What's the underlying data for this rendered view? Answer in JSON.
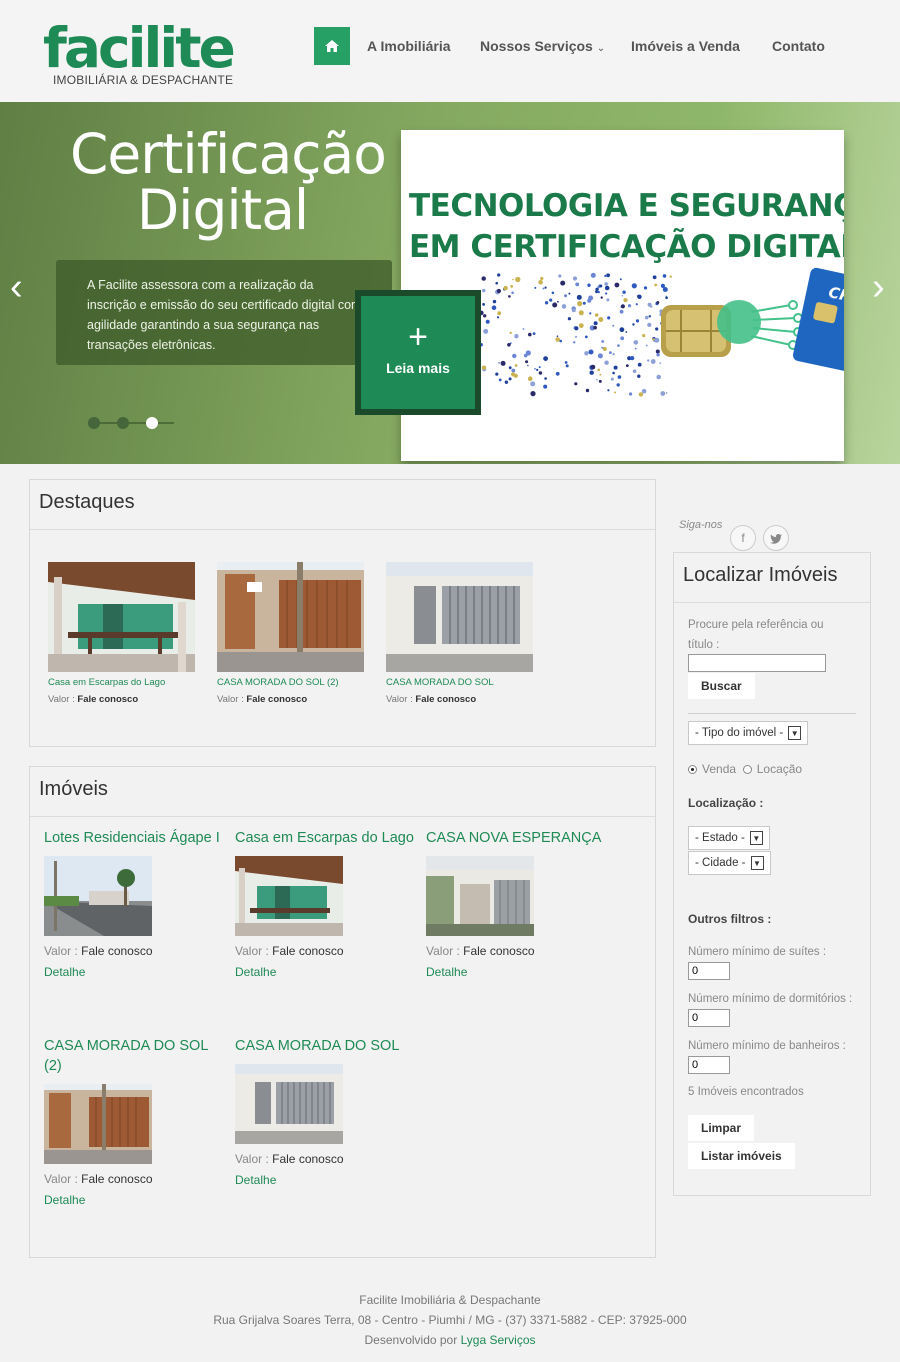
{
  "header": {
    "logo_word": "facilite",
    "logo_sub": "IMOBILIÁRIA & DESPACHANTE",
    "nav": {
      "home_icon": "home-icon",
      "items": [
        "A Imobiliária",
        "Nossos Serviços",
        "Imóveis a Venda",
        "Contato"
      ],
      "dropdown_glyph": "⌄"
    }
  },
  "slider": {
    "title_line1": "Certificação",
    "title_line2": "Digital",
    "caption": "A Facilite assessora com a realização da inscrição e emissão do seu certificado digital com agilidade garantindo a sua segurança nas transações eletrônicas.",
    "button_plus": "+",
    "button_label": "Leia mais",
    "banner_line1": "TECNOLOGIA E SEGURANÇA",
    "banner_line2": "EM CERTIFICAÇÃO DIGITAL",
    "card_text": "CPF",
    "active_dot": 2,
    "prev_arrow": "‹",
    "next_arrow": "›",
    "colors": {
      "brand": "#1e8a55",
      "brand_dark": "#1b7a49"
    }
  },
  "destaques": {
    "title": "Destaques",
    "items": [
      {
        "name": "Casa em Escarpas do Lago",
        "value_label": "Valor :",
        "value": "Fale conosco"
      },
      {
        "name": "CASA MORADA DO SOL (2)",
        "value_label": "Valor :",
        "value": "Fale conosco"
      },
      {
        "name": "CASA MORADA DO SOL",
        "value_label": "Valor :",
        "value": "Fale conosco"
      }
    ]
  },
  "imoveis": {
    "title": "Imóveis",
    "items": [
      {
        "name": "Lotes Residenciais Ágape I",
        "value_label": "Valor :",
        "value": "Fale conosco",
        "detail": "Detalhe"
      },
      {
        "name": "Casa em Escarpas do Lago",
        "value_label": "Valor :",
        "value": "Fale conosco",
        "detail": "Detalhe"
      },
      {
        "name": "CASA NOVA ESPERANÇA",
        "value_label": "Valor :",
        "value": "Fale conosco",
        "detail": "Detalhe"
      },
      {
        "name": "CASA MORADA DO SOL (2)",
        "value_label": "Valor :",
        "value": "Fale conosco",
        "detail": "Detalhe"
      },
      {
        "name": "CASA MORADA DO SOL",
        "value_label": "Valor :",
        "value": "Fale conosco",
        "detail": "Detalhe"
      }
    ]
  },
  "sidebar": {
    "siga": "Siga-nos",
    "social": [
      "f",
      "t"
    ],
    "title": "Localizar Imóveis",
    "search_label": "Procure pela referência ou título :",
    "search_value": "",
    "search_button": "Buscar",
    "tipo_select": "- Tipo do imóvel -",
    "radio_venda": "Venda",
    "radio_locacao": "Locação",
    "localizacao_label": "Localização :",
    "estado_select": "- Estado -",
    "cidade_select": "- Cidade -",
    "outros_label": "Outros filtros :",
    "suites_label": "Número mínimo de suítes :",
    "suites_value": "0",
    "dormitorios_label": "Número mínimo de dormitórios :",
    "dormitorios_value": "0",
    "banheiros_label": "Número mínimo de banheiros :",
    "banheiros_value": "0",
    "found_count": "5 Imóveis encontrados",
    "limpar_button": "Limpar",
    "listar_button": "Listar imóveis"
  },
  "footer": {
    "line1": "Facilite Imobiliária & Despachante",
    "line2": "Rua Grijalva Soares Terra, 08 - Centro - Piumhi / MG - (37) 3371-5882 - CEP: 37925-000",
    "line3_prefix": "Desenvolvido por",
    "line3_link": "Lyga Serviços"
  }
}
